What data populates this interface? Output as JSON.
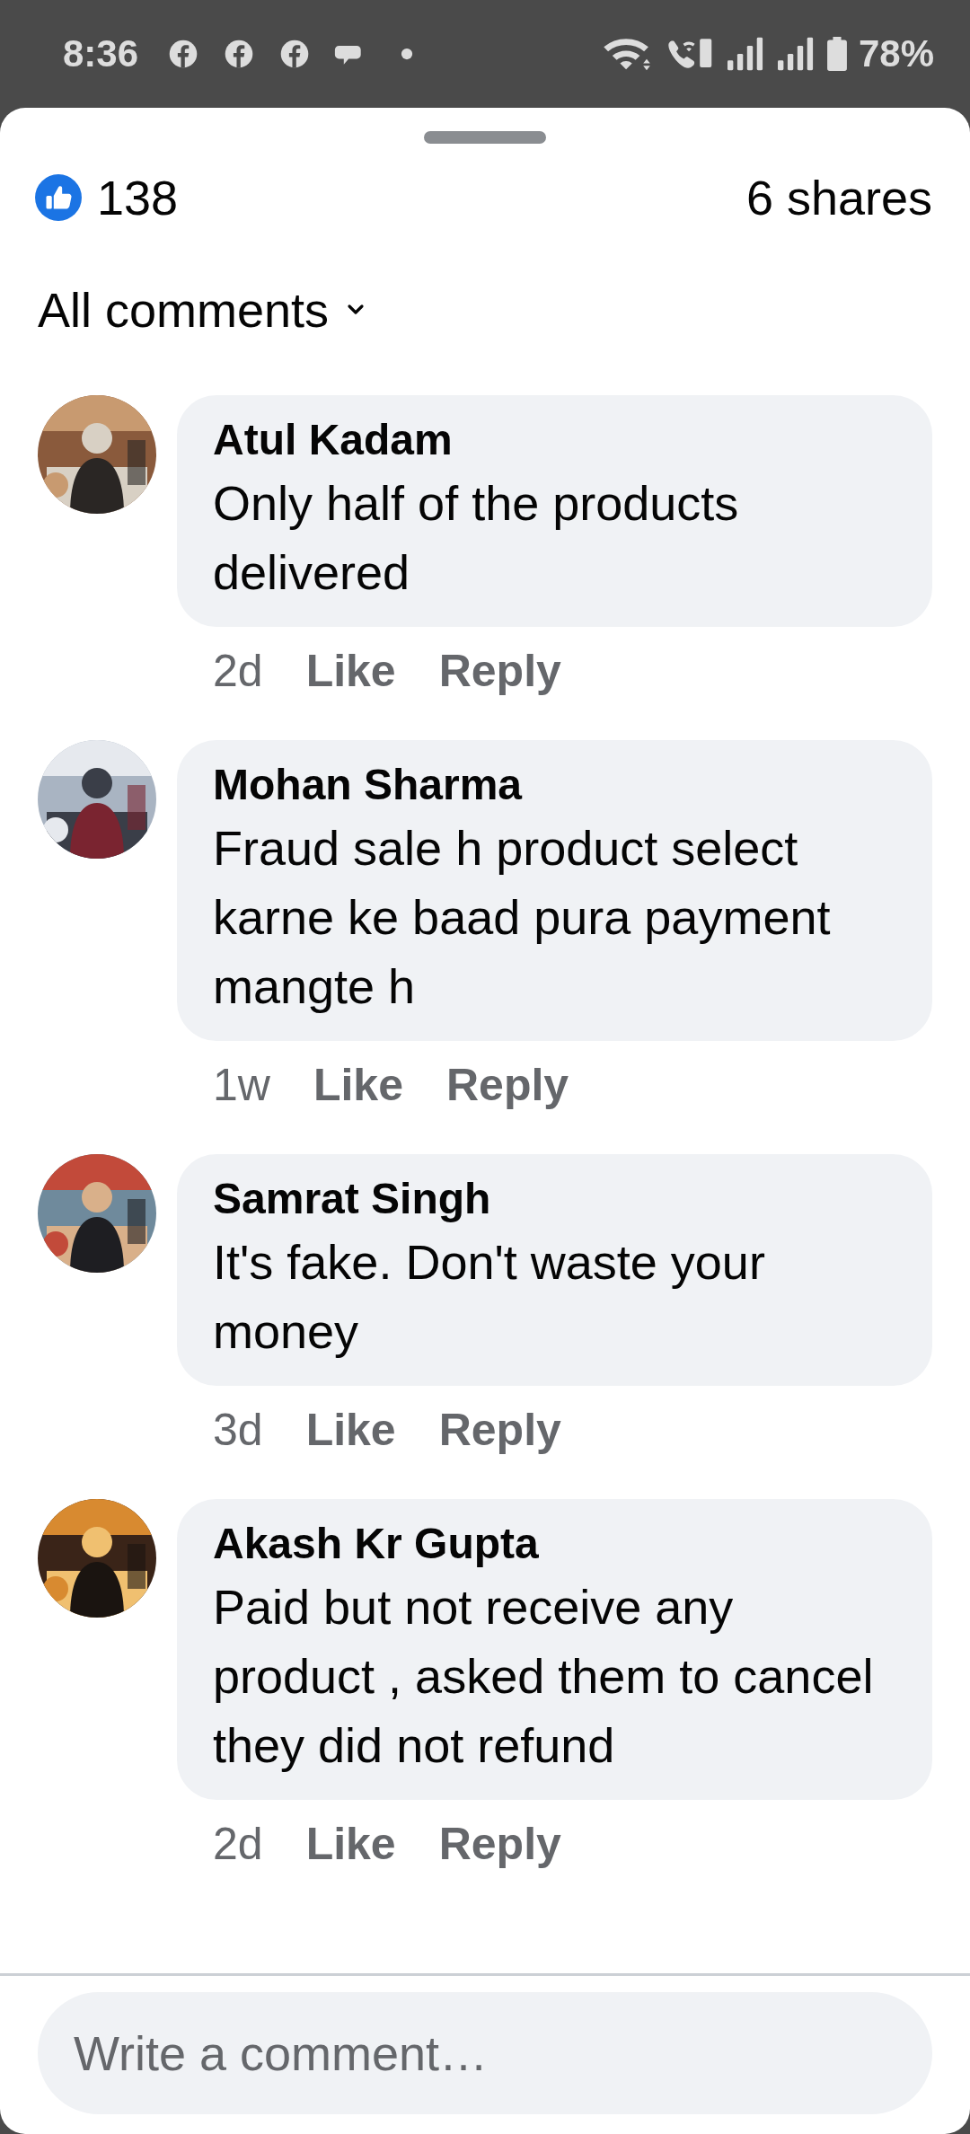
{
  "status_bar": {
    "time": "8:36",
    "battery": "78%"
  },
  "reactions": {
    "count": "138",
    "shares": "6 shares"
  },
  "filter": {
    "label": "All comments"
  },
  "comments": [
    {
      "author": "Atul Kadam",
      "text": "Only half of the products delivered",
      "time": "2d",
      "like": "Like",
      "reply": "Reply"
    },
    {
      "author": "Mohan Sharma",
      "text": "Fraud sale h product select karne ke baad pura payment mangte h",
      "time": "1w",
      "like": "Like",
      "reply": "Reply"
    },
    {
      "author": "Samrat Singh",
      "text": "It's fake. Don't waste your money",
      "time": "3d",
      "like": "Like",
      "reply": "Reply"
    },
    {
      "author": "Akash Kr Gupta",
      "text": "Paid but not receive any product , asked them  to cancel they did not refund",
      "time": "2d",
      "like": "Like",
      "reply": "Reply"
    }
  ],
  "composer": {
    "placeholder": "Write a comment…"
  }
}
